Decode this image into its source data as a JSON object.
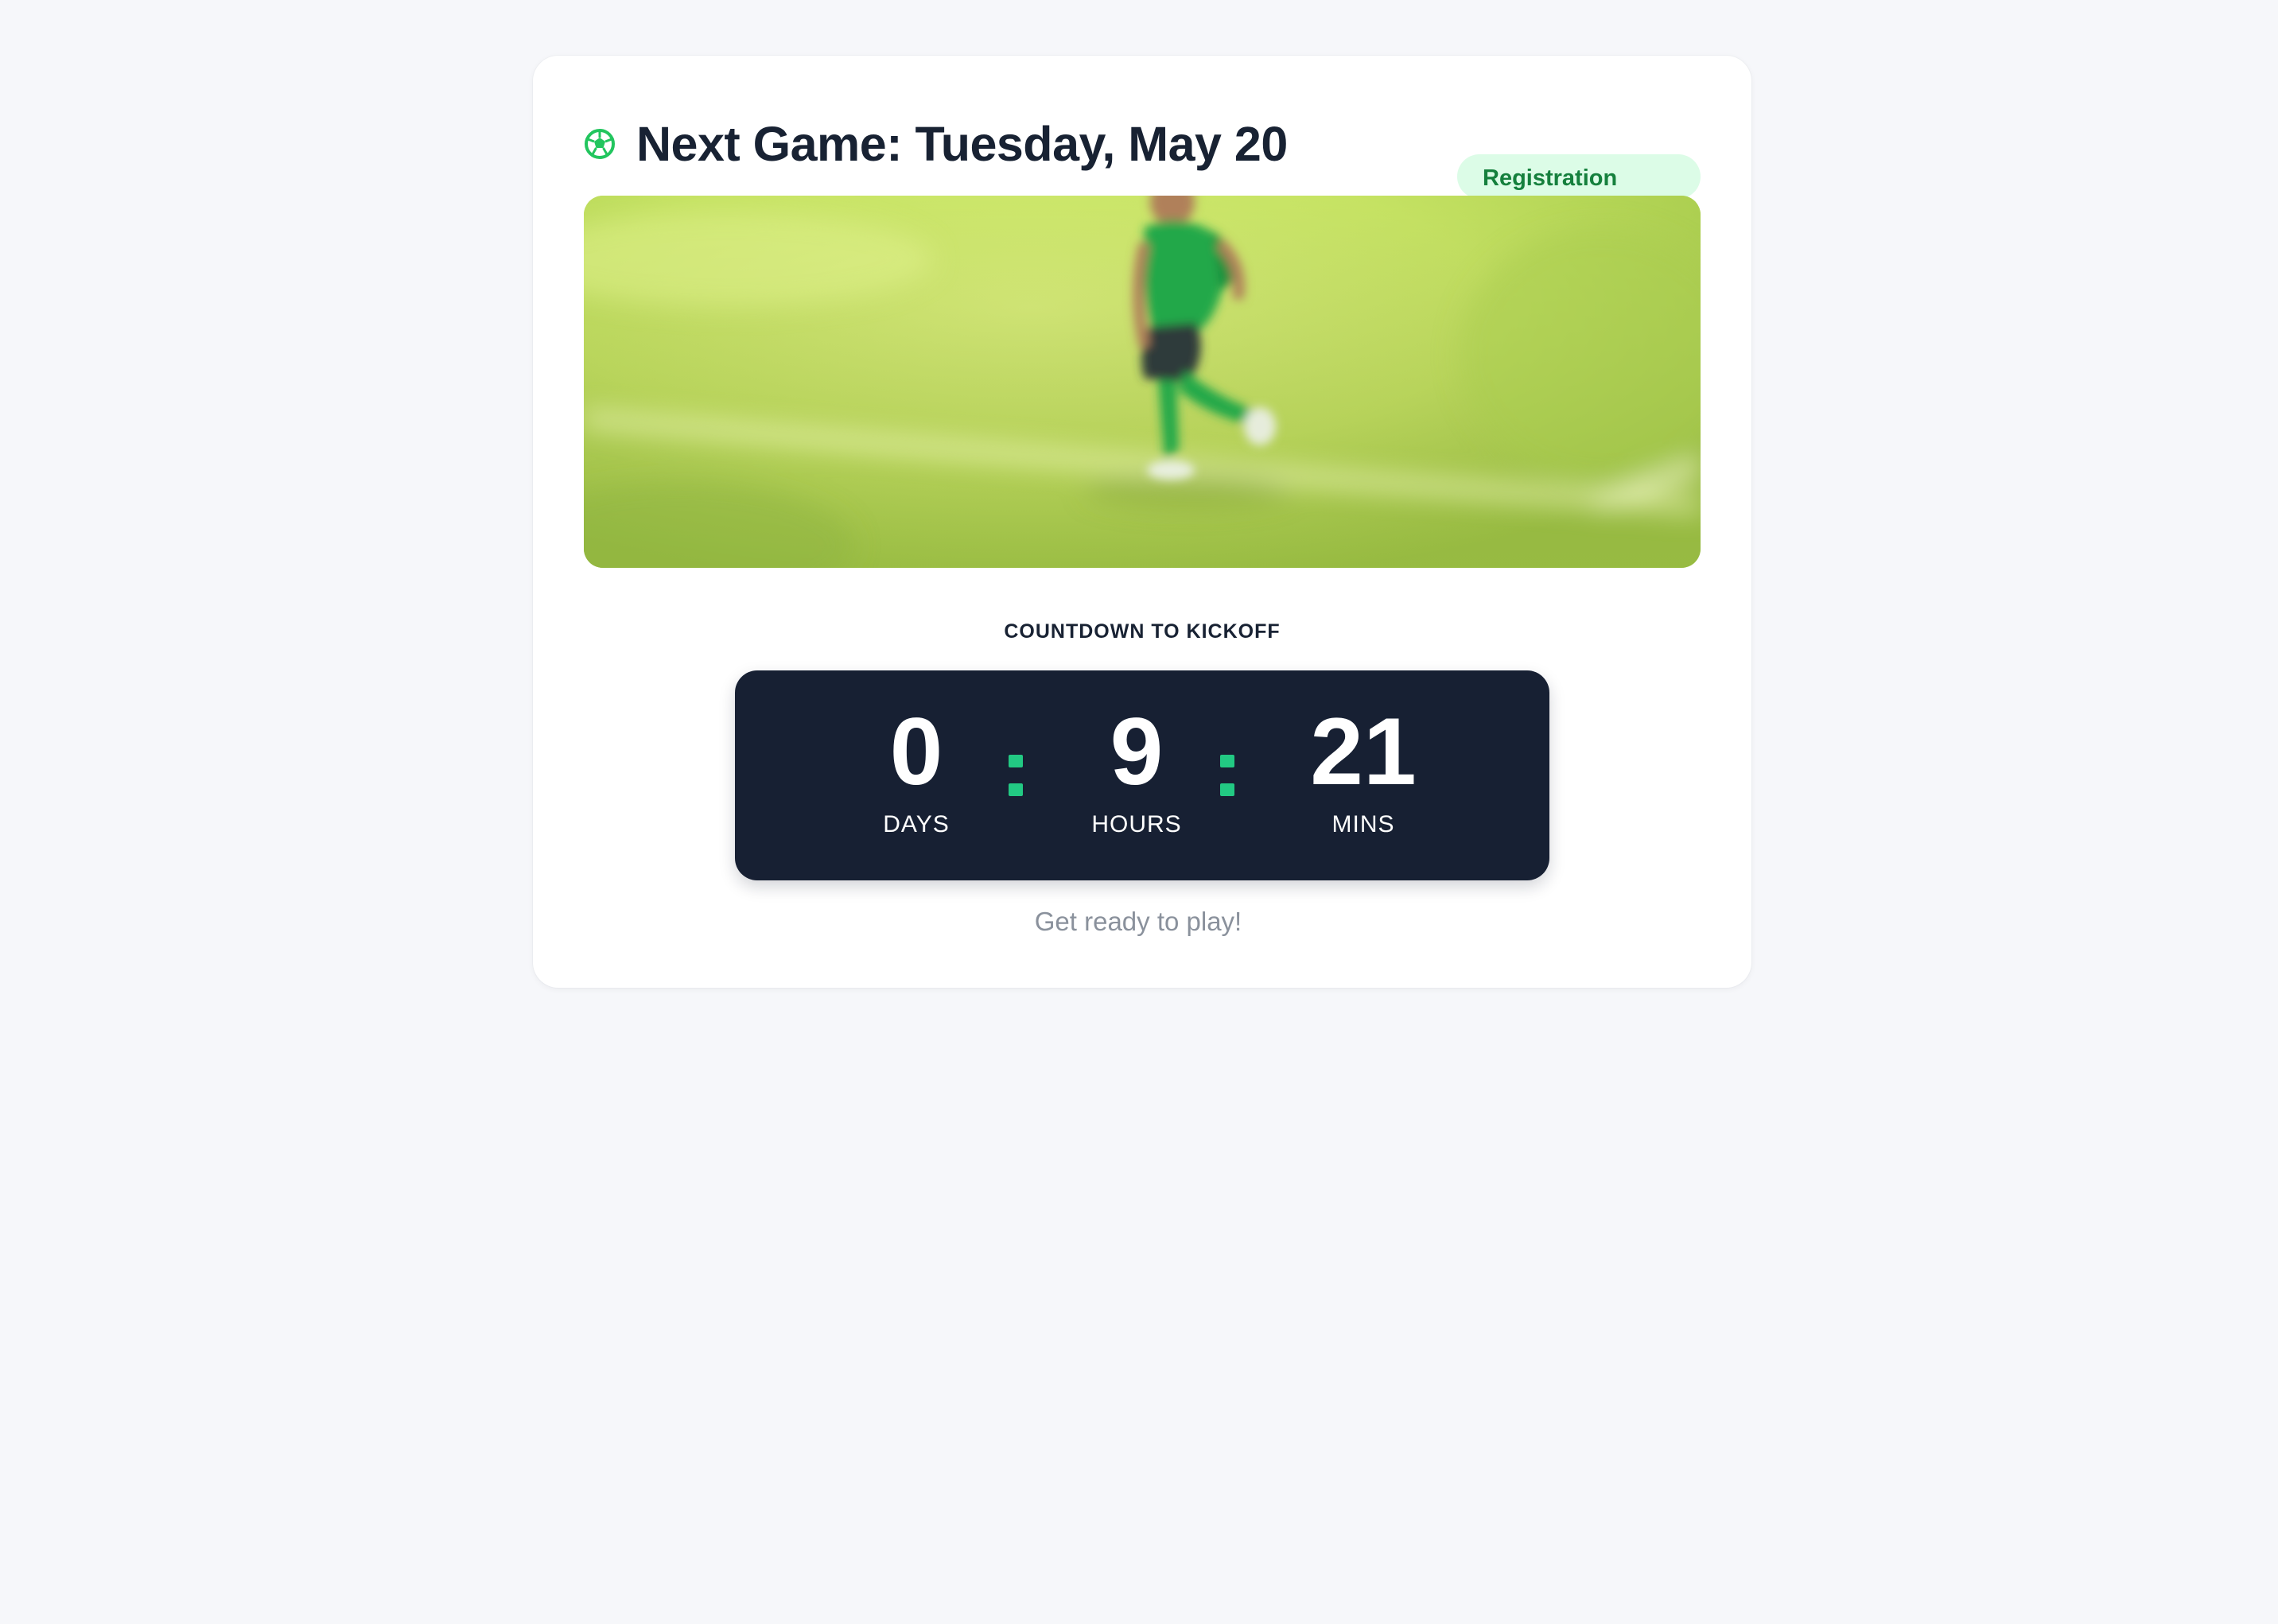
{
  "game": {
    "title": "Next Game: Tuesday, May 20",
    "status_badge": "Registration Open"
  },
  "hero_image": {
    "subject": "soccer player running on grass field"
  },
  "countdown": {
    "label": "COUNTDOWN TO KICKOFF",
    "units": [
      {
        "value": "0",
        "label": "DAYS"
      },
      {
        "value": "9",
        "label": "HOURS"
      },
      {
        "value": "21",
        "label": "MINS"
      }
    ],
    "separator": ":"
  },
  "footer": {
    "message": "Get ready to play!"
  },
  "colors": {
    "background": "#f6f7fa",
    "card": "#ffffff",
    "title": "#182233",
    "badge_bg": "#dcfce7",
    "badge_text": "#15803d",
    "timer_bg": "#172033",
    "accent_green": "#22c983",
    "muted_text": "#8a919c"
  },
  "icons": {
    "title_icon": "soccer-ball-icon"
  }
}
